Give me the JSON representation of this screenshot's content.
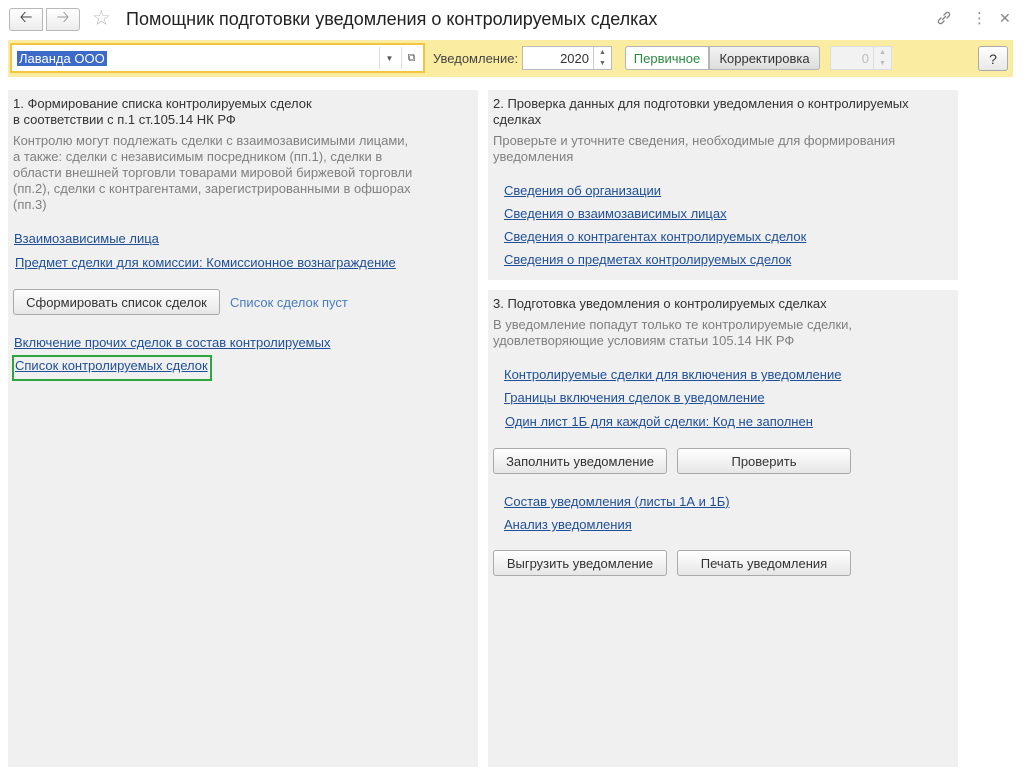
{
  "window": {
    "title": "Помощник подготовки уведомления о контролируемых сделках"
  },
  "toolbar": {
    "organization": "Лаванда ООО",
    "notice_label": "Уведомление:",
    "year": "2020",
    "mode_primary": "Первичное",
    "mode_correction": "Корректировка",
    "correction_number": "0",
    "help": "?"
  },
  "section1": {
    "heading_line1": "1. Формирование списка контролируемых сделок",
    "heading_line2": "в соответствии с п.1 ст.105.14 НК РФ",
    "desc_lines": [
      "Контролю могут подлежать сделки с взаимозависимыми лицами,",
      "а также: сделки с независимым посредником (пп.1), сделки в",
      "области внешней торговли товарами мировой биржевой торговли",
      "(пп.2), сделки с контрагентами, зарегистрированными в офшорах",
      "(пп.3)"
    ],
    "link_related": "Взаимозависимые лица",
    "link_subject": "Предмет сделки для комиссии: Комиссионное вознаграждение",
    "btn_form_list": "Сформировать список сделок",
    "list_status": "Список сделок пуст",
    "link_include_other": "Включение прочих сделок в состав контролируемых",
    "link_controlled_list": "Список контролируемых сделок"
  },
  "section2": {
    "heading_line1": "2. Проверка данных для подготовки уведомления о контролируемых",
    "heading_line2": "сделках",
    "desc_line1": "Проверьте и уточните сведения, необходимые для формирования",
    "desc_line2": "уведомления",
    "links": [
      "Сведения об организации",
      "Сведения о взаимозависимых лицах",
      "Сведения о контрагентах контролируемых сделок",
      "Сведения о предметах контролируемых сделок"
    ]
  },
  "section3": {
    "heading": "3. Подготовка уведомления о контролируемых сделках",
    "desc_line1": "В уведомление попадут только те контролируемые сделки,",
    "desc_line2": "удовлетворяющие условиям статьи 105.14 НК РФ",
    "links_top": [
      "Контролируемые сделки для включения в уведомление",
      "Границы включения сделок в уведомление",
      "Один лист 1Б для каждой сделки: Код не заполнен"
    ],
    "btn_fill": "Заполнить уведомление",
    "btn_check": "Проверить",
    "links_bottom": [
      "Состав уведомления (листы 1А и 1Б)",
      "Анализ уведомления"
    ],
    "btn_export": "Выгрузить уведомление",
    "btn_print": "Печать уведомления"
  }
}
